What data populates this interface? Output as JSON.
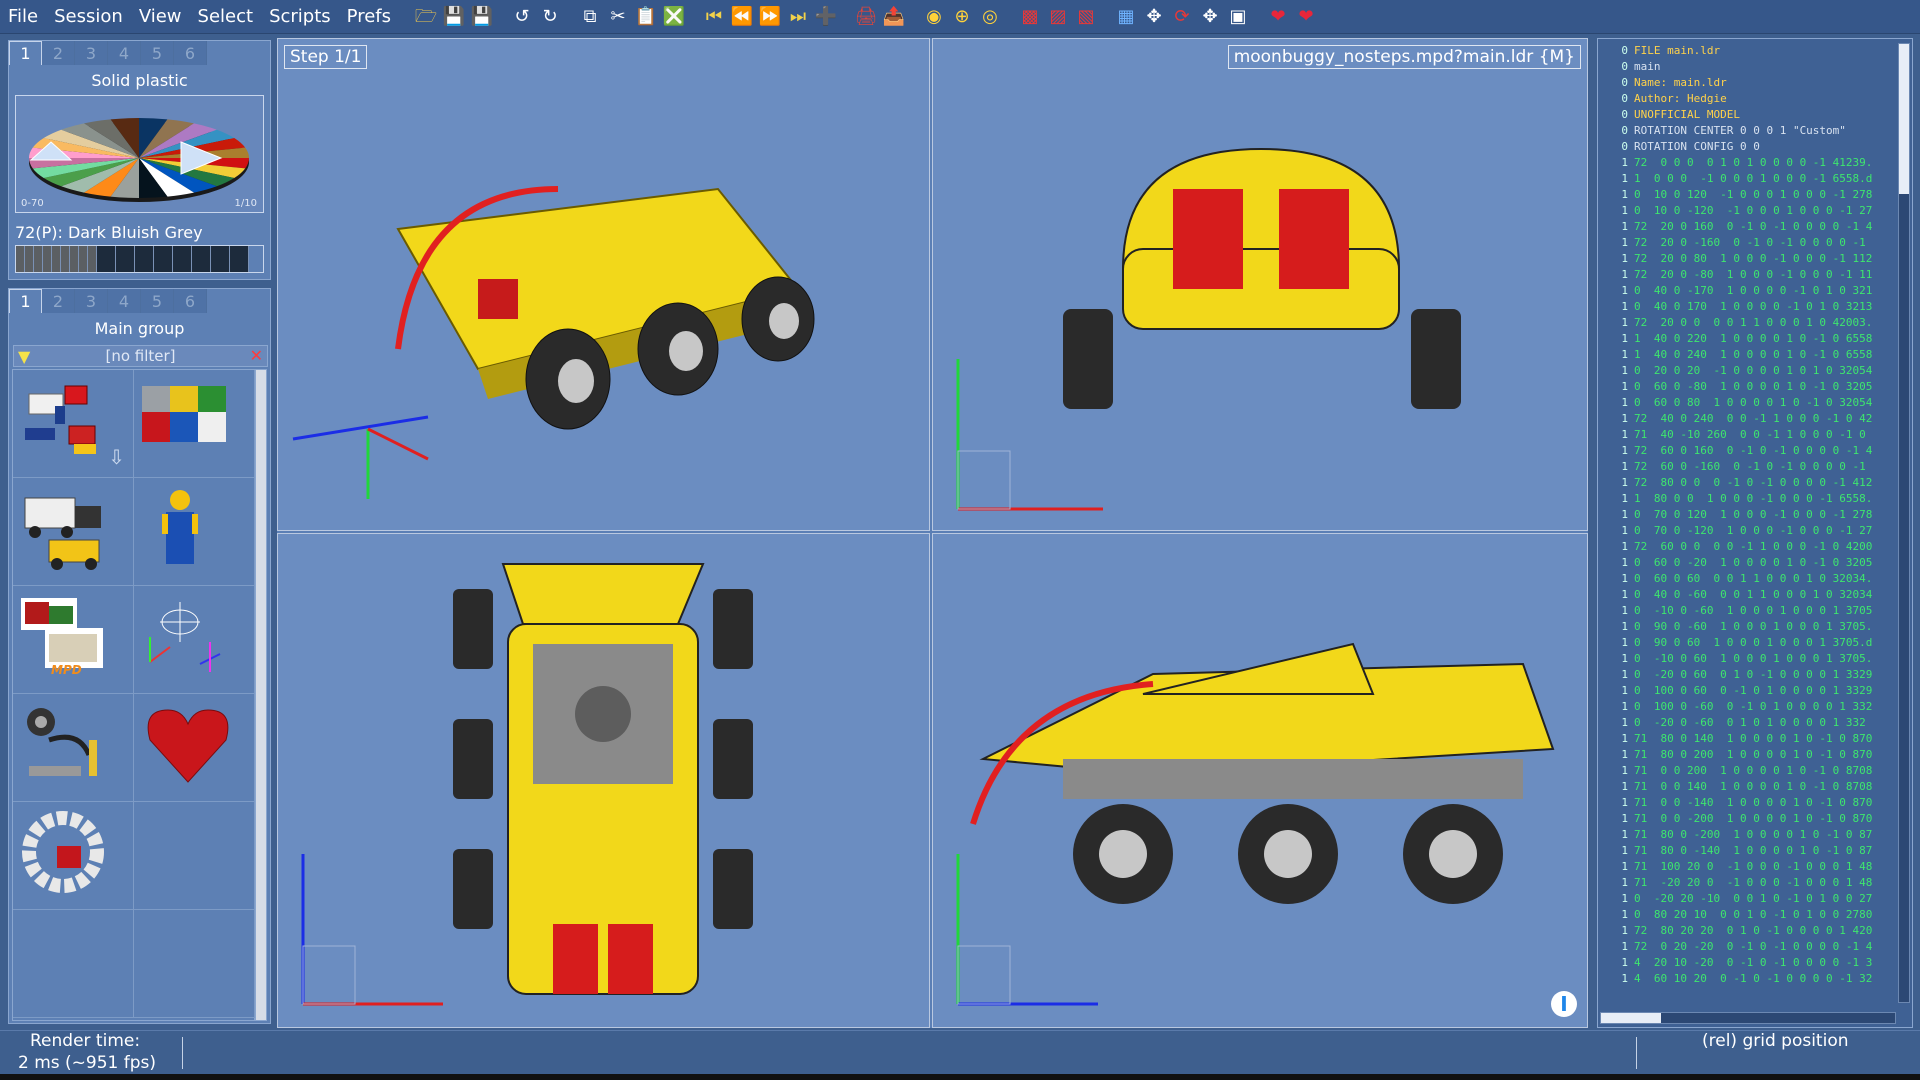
{
  "menu": [
    "File",
    "Session",
    "View",
    "Select",
    "Scripts",
    "Prefs"
  ],
  "toolbar_icons": [
    "open-file-icon",
    "save-icon",
    "save-as-icon",
    "undo-icon",
    "redo-icon",
    "copy-icon",
    "cut-icon",
    "paste-icon",
    "delete-icon",
    "first-step-icon",
    "prev-step-icon",
    "next-step-icon",
    "last-step-icon",
    "add-step-icon",
    "print-icon",
    "export-icon",
    "color-circle-icon",
    "color-add-icon",
    "color-target-icon",
    "hide-icon",
    "show-icon",
    "invert-icon",
    "snap-grid-icon",
    "move-icon",
    "rotate-icon",
    "pan-icon",
    "zoom-fit-icon",
    "favorite-icon",
    "favorite-add-icon"
  ],
  "color_panel": {
    "tabs": [
      "1",
      "2",
      "3",
      "4",
      "5",
      "6"
    ],
    "active_tab": "1",
    "title": "Solid plastic",
    "wheel_left_label": "0-70",
    "wheel_right_label": "1/10",
    "selected_color": "72(P): Dark Bluish Grey",
    "swatches": [
      "#5b5f63",
      "#5b5f63",
      "#5b5f63",
      "#5b5f63",
      "#5b5f63",
      "#5b5f63",
      "#5b5f63",
      "#5b5f63",
      "#5b5f63",
      "#1d2b3c",
      "#1d2b3c",
      "#1d2b3c",
      "#1d2b3c",
      "#1d2b3c",
      "#1d2b3c",
      "#1d2b3c",
      "#1d2b3c"
    ]
  },
  "parts_panel": {
    "tabs": [
      "1",
      "2",
      "3",
      "4",
      "5",
      "6"
    ],
    "active_tab": "1",
    "title": "Main group",
    "filter_text": "[no filter]",
    "groups": [
      "bricks-mix",
      "colored-bricks",
      "minifig-vehicles",
      "minifig",
      "mpd-models",
      "orientation-gizmo",
      "technic-parts",
      "heart-shape",
      "ring-shape"
    ]
  },
  "viewport": {
    "step_label": "Step 1/1",
    "model_label": "moonbuggy_nosteps.mpd?main.ldr {M}",
    "info_icon": "I"
  },
  "ldraw_lines": [
    [
      "0",
      "FILE main.ldr",
      "kw"
    ],
    [
      "0",
      "main",
      ""
    ],
    [
      "0",
      "Name: main.ldr",
      "kw"
    ],
    [
      "0",
      "Author: Hedgie",
      "kw"
    ],
    [
      "0",
      "UNOFFICIAL MODEL",
      "kw"
    ],
    [
      "0",
      "ROTATION CENTER 0 0 0 1 \"Custom\"",
      ""
    ],
    [
      "0",
      "ROTATION CONFIG 0 0",
      ""
    ],
    [
      "1",
      "72  0 0 0  0 1 0 1 0 0 0 0 -1 41239.",
      "hl"
    ],
    [
      "1",
      "1  0 0 0  -1 0 0 0 1 0 0 0 -1 6558.d",
      "hl"
    ],
    [
      "1",
      "0  10 0 120  -1 0 0 0 1 0 0 0 -1 278",
      "hl"
    ],
    [
      "1",
      "0  10 0 -120  -1 0 0 0 1 0 0 0 -1 27",
      "hl"
    ],
    [
      "1",
      "72  20 0 160  0 -1 0 -1 0 0 0 0 -1 4",
      "hl"
    ],
    [
      "1",
      "72  20 0 -160  0 -1 0 -1 0 0 0 0 -1",
      "hl"
    ],
    [
      "1",
      "72  20 0 80  1 0 0 0 -1 0 0 0 -1 112",
      "hl"
    ],
    [
      "1",
      "72  20 0 -80  1 0 0 0 -1 0 0 0 -1 11",
      "hl"
    ],
    [
      "1",
      "0  40 0 -170  1 0 0 0 0 -1 0 1 0 321",
      "hl"
    ],
    [
      "1",
      "0  40 0 170  1 0 0 0 0 -1 0 1 0 3213",
      "hl"
    ],
    [
      "1",
      "72  20 0 0  0 0 1 1 0 0 0 1 0 42003.",
      "hl"
    ],
    [
      "1",
      "1  40 0 220  1 0 0 0 0 1 0 -1 0 6558",
      "hl"
    ],
    [
      "1",
      "1  40 0 240  1 0 0 0 0 1 0 -1 0 6558",
      "hl"
    ],
    [
      "1",
      "0  20 0 20  -1 0 0 0 0 1 0 1 0 32054",
      "hl"
    ],
    [
      "1",
      "0  60 0 -80  1 0 0 0 0 1 0 -1 0 3205",
      "hl"
    ],
    [
      "1",
      "0  60 0 80  1 0 0 0 0 1 0 -1 0 32054",
      "hl"
    ],
    [
      "1",
      "72  40 0 240  0 0 -1 1 0 0 0 -1 0 42",
      "hl"
    ],
    [
      "1",
      "71  40 -10 260  0 0 -1 1 0 0 0 -1 0",
      "hl"
    ],
    [
      "1",
      "72  60 0 160  0 -1 0 -1 0 0 0 0 -1 4",
      "hl"
    ],
    [
      "1",
      "72  60 0 -160  0 -1 0 -1 0 0 0 0 -1",
      "hl"
    ],
    [
      "1",
      "72  80 0 0  0 -1 0 -1 0 0 0 0 -1 412",
      "hl"
    ],
    [
      "1",
      "1  80 0 0  1 0 0 0 -1 0 0 0 -1 6558.",
      "hl"
    ],
    [
      "1",
      "0  70 0 120  1 0 0 0 -1 0 0 0 -1 278",
      "hl"
    ],
    [
      "1",
      "0  70 0 -120  1 0 0 0 -1 0 0 0 -1 27",
      "hl"
    ],
    [
      "1",
      "72  60 0 0  0 0 -1 1 0 0 0 -1 0 4200",
      "hl"
    ],
    [
      "1",
      "0  60 0 -20  1 0 0 0 0 1 0 -1 0 3205",
      "hl"
    ],
    [
      "1",
      "0  60 0 60  0 0 1 1 0 0 0 1 0 32034.",
      "hl"
    ],
    [
      "1",
      "0  40 0 -60  0 0 1 1 0 0 0 1 0 32034",
      "hl"
    ],
    [
      "1",
      "0  -10 0 -60  1 0 0 0 1 0 0 0 1 3705",
      "hl"
    ],
    [
      "1",
      "0  90 0 -60  1 0 0 0 1 0 0 0 1 3705.",
      "hl"
    ],
    [
      "1",
      "0  90 0 60  1 0 0 0 1 0 0 0 1 3705.d",
      "hl"
    ],
    [
      "1",
      "0  -10 0 60  1 0 0 0 1 0 0 0 1 3705.",
      "hl"
    ],
    [
      "1",
      "0  -20 0 60  0 1 0 -1 0 0 0 0 1 3329",
      "hl"
    ],
    [
      "1",
      "0  100 0 60  0 -1 0 1 0 0 0 0 1 3329",
      "hl"
    ],
    [
      "1",
      "0  100 0 -60  0 -1 0 1 0 0 0 0 1 332",
      "hl"
    ],
    [
      "1",
      "0  -20 0 -60  0 1 0 1 0 0 0 0 1 332",
      "hl"
    ],
    [
      "1",
      "71  80 0 140  1 0 0 0 0 1 0 -1 0 870",
      "hl"
    ],
    [
      "1",
      "71  80 0 200  1 0 0 0 0 1 0 -1 0 870",
      "hl"
    ],
    [
      "1",
      "71  0 0 200  1 0 0 0 0 1 0 -1 0 8708",
      "hl"
    ],
    [
      "1",
      "71  0 0 140  1 0 0 0 0 1 0 -1 0 8708",
      "hl"
    ],
    [
      "1",
      "71  0 0 -140  1 0 0 0 0 1 0 -1 0 870",
      "hl"
    ],
    [
      "1",
      "71  0 0 -200  1 0 0 0 0 1 0 -1 0 870",
      "hl"
    ],
    [
      "1",
      "71  80 0 -200  1 0 0 0 0 1 0 -1 0 87",
      "hl"
    ],
    [
      "1",
      "71  80 0 -140  1 0 0 0 0 1 0 -1 0 87",
      "hl"
    ],
    [
      "1",
      "71  100 20 0  -1 0 0 0 -1 0 0 0 1 48",
      "hl"
    ],
    [
      "1",
      "71  -20 20 0  -1 0 0 0 -1 0 0 0 1 48",
      "hl"
    ],
    [
      "1",
      "0  -20 20 -10  0 0 1 0 -1 0 1 0 0 27",
      "hl"
    ],
    [
      "1",
      "0  80 20 10  0 0 1 0 -1 0 1 0 0 2780",
      "hl"
    ],
    [
      "1",
      "72  80 20 20  0 1 0 -1 0 0 0 0 1 420",
      "hl"
    ],
    [
      "1",
      "72  0 20 -20  0 -1 0 -1 0 0 0 0 -1 4",
      "hl"
    ],
    [
      "1",
      "4  20 10 -20  0 -1 0 -1 0 0 0 0 -1 3",
      "hl"
    ],
    [
      "1",
      "4  60 10 20  0 -1 0 -1 0 0 0 0 -1 32",
      "hl"
    ]
  ],
  "status": {
    "render_label": "Render time:",
    "render_value": "2 ms (~951 fps)",
    "grid_position": "(rel) grid position"
  }
}
